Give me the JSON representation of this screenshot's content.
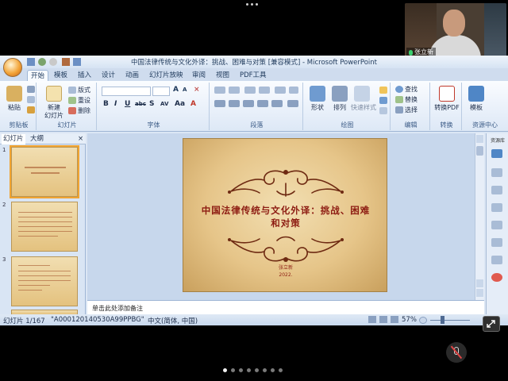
{
  "window": {
    "title": "中国法律传统与文化外译：挑战、困难与对策 [兼容模式] - Microsoft PowerPoint"
  },
  "video": {
    "participant_name": "张立新"
  },
  "ribbon": {
    "tabs": [
      "开始",
      "模板",
      "插入",
      "设计",
      "动画",
      "幻灯片放映",
      "审阅",
      "视图",
      "PDF工具"
    ],
    "active_tab": "开始",
    "groups": {
      "clipboard": {
        "label": "剪贴板",
        "paste": "粘贴"
      },
      "slides": {
        "label": "幻灯片",
        "new_slide_1": "新建",
        "new_slide_2": "幻灯片",
        "layout": "版式",
        "reset": "重设",
        "delete": "删除"
      },
      "font": {
        "label": "字体",
        "bold": "B",
        "italic": "I",
        "underline": "U",
        "strike": "abc",
        "shadow": "S",
        "spacing": "AV",
        "case": "Aa",
        "color": "A"
      },
      "paragraph": {
        "label": "段落"
      },
      "drawing": {
        "label": "绘图",
        "shapes": "形状",
        "arrange": "排列",
        "quick_styles": "快速样式"
      },
      "editing": {
        "label": "编辑",
        "find": "查找",
        "replace": "替换",
        "select": "选择"
      },
      "convert": {
        "label": "转换",
        "to_pdf": "转换PDF"
      },
      "resources": {
        "label": "资源中心",
        "template": "模板"
      }
    }
  },
  "panel": {
    "tab_slides": "幻灯片",
    "tab_outline": "大纲",
    "close": "×",
    "thumb_numbers": [
      "1",
      "2",
      "3"
    ]
  },
  "slide": {
    "title": "中国法律传统与文化外译：挑战、困难和对策",
    "author": "张立新",
    "date": "2022."
  },
  "notes": {
    "placeholder": "单击此处添加备注"
  },
  "right_pane": {
    "header": "资源库"
  },
  "status": {
    "slide_count": "幻灯片 1/167",
    "theme": "\"A000120140530A99PPBG\"",
    "language": "中文(简体, 中国)",
    "zoom": "57%"
  },
  "colors": {
    "accent_title": "#8d1c12",
    "ribbon_blue": "#1e395b"
  },
  "pager": {
    "count": 8,
    "active": 0
  }
}
